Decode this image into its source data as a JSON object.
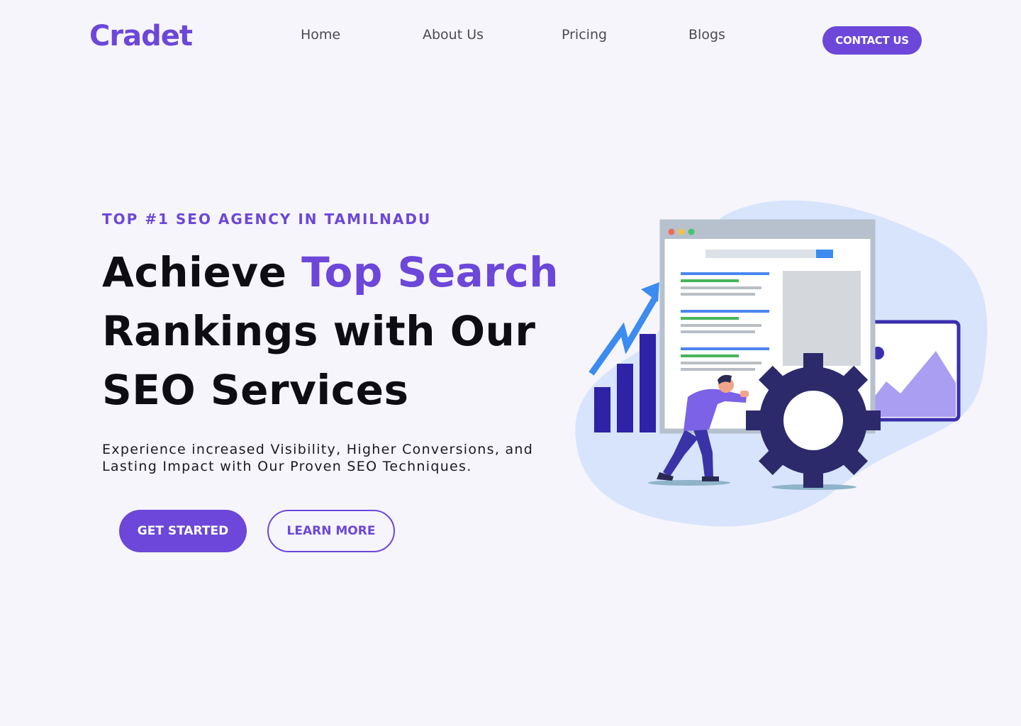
{
  "brand": {
    "logo_text": "Cradet",
    "accent_color": "#6c47d9"
  },
  "nav": {
    "items": [
      {
        "label": "Home"
      },
      {
        "label": "About Us"
      },
      {
        "label": "Pricing"
      },
      {
        "label": "Blogs"
      }
    ],
    "cta_label": "CONTACT US"
  },
  "hero": {
    "eyebrow": "TOP #1 SEO AGENCY IN TAMILNADU",
    "headline_part1": "Achieve ",
    "headline_accent": "Top Search",
    "headline_part2": "Rankings with Our",
    "headline_part3": "SEO Services",
    "subtext": "Experience increased Visibility, Higher Conversions, and Lasting Impact with Our Proven SEO Techniques.",
    "primary_button": "GET STARTED",
    "secondary_button": "LEARN MORE"
  },
  "illustration": {
    "icons": [
      "browser-window-icon",
      "growth-arrow-icon",
      "bar-chart-icon",
      "gear-icon",
      "person-pushing-icon",
      "image-icon"
    ]
  }
}
